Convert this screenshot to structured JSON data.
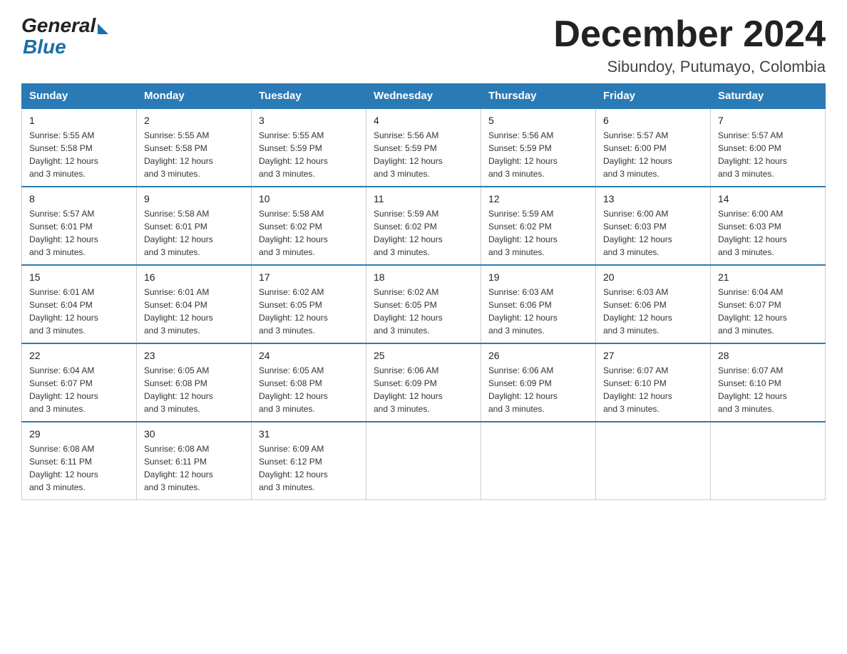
{
  "header": {
    "logo_general": "General",
    "logo_blue": "Blue",
    "title": "December 2024",
    "subtitle": "Sibundoy, Putumayo, Colombia"
  },
  "weekdays": [
    "Sunday",
    "Monday",
    "Tuesday",
    "Wednesday",
    "Thursday",
    "Friday",
    "Saturday"
  ],
  "weeks": [
    [
      {
        "day": "1",
        "info": "Sunrise: 5:55 AM\nSunset: 5:58 PM\nDaylight: 12 hours\nand 3 minutes."
      },
      {
        "day": "2",
        "info": "Sunrise: 5:55 AM\nSunset: 5:58 PM\nDaylight: 12 hours\nand 3 minutes."
      },
      {
        "day": "3",
        "info": "Sunrise: 5:55 AM\nSunset: 5:59 PM\nDaylight: 12 hours\nand 3 minutes."
      },
      {
        "day": "4",
        "info": "Sunrise: 5:56 AM\nSunset: 5:59 PM\nDaylight: 12 hours\nand 3 minutes."
      },
      {
        "day": "5",
        "info": "Sunrise: 5:56 AM\nSunset: 5:59 PM\nDaylight: 12 hours\nand 3 minutes."
      },
      {
        "day": "6",
        "info": "Sunrise: 5:57 AM\nSunset: 6:00 PM\nDaylight: 12 hours\nand 3 minutes."
      },
      {
        "day": "7",
        "info": "Sunrise: 5:57 AM\nSunset: 6:00 PM\nDaylight: 12 hours\nand 3 minutes."
      }
    ],
    [
      {
        "day": "8",
        "info": "Sunrise: 5:57 AM\nSunset: 6:01 PM\nDaylight: 12 hours\nand 3 minutes."
      },
      {
        "day": "9",
        "info": "Sunrise: 5:58 AM\nSunset: 6:01 PM\nDaylight: 12 hours\nand 3 minutes."
      },
      {
        "day": "10",
        "info": "Sunrise: 5:58 AM\nSunset: 6:02 PM\nDaylight: 12 hours\nand 3 minutes."
      },
      {
        "day": "11",
        "info": "Sunrise: 5:59 AM\nSunset: 6:02 PM\nDaylight: 12 hours\nand 3 minutes."
      },
      {
        "day": "12",
        "info": "Sunrise: 5:59 AM\nSunset: 6:02 PM\nDaylight: 12 hours\nand 3 minutes."
      },
      {
        "day": "13",
        "info": "Sunrise: 6:00 AM\nSunset: 6:03 PM\nDaylight: 12 hours\nand 3 minutes."
      },
      {
        "day": "14",
        "info": "Sunrise: 6:00 AM\nSunset: 6:03 PM\nDaylight: 12 hours\nand 3 minutes."
      }
    ],
    [
      {
        "day": "15",
        "info": "Sunrise: 6:01 AM\nSunset: 6:04 PM\nDaylight: 12 hours\nand 3 minutes."
      },
      {
        "day": "16",
        "info": "Sunrise: 6:01 AM\nSunset: 6:04 PM\nDaylight: 12 hours\nand 3 minutes."
      },
      {
        "day": "17",
        "info": "Sunrise: 6:02 AM\nSunset: 6:05 PM\nDaylight: 12 hours\nand 3 minutes."
      },
      {
        "day": "18",
        "info": "Sunrise: 6:02 AM\nSunset: 6:05 PM\nDaylight: 12 hours\nand 3 minutes."
      },
      {
        "day": "19",
        "info": "Sunrise: 6:03 AM\nSunset: 6:06 PM\nDaylight: 12 hours\nand 3 minutes."
      },
      {
        "day": "20",
        "info": "Sunrise: 6:03 AM\nSunset: 6:06 PM\nDaylight: 12 hours\nand 3 minutes."
      },
      {
        "day": "21",
        "info": "Sunrise: 6:04 AM\nSunset: 6:07 PM\nDaylight: 12 hours\nand 3 minutes."
      }
    ],
    [
      {
        "day": "22",
        "info": "Sunrise: 6:04 AM\nSunset: 6:07 PM\nDaylight: 12 hours\nand 3 minutes."
      },
      {
        "day": "23",
        "info": "Sunrise: 6:05 AM\nSunset: 6:08 PM\nDaylight: 12 hours\nand 3 minutes."
      },
      {
        "day": "24",
        "info": "Sunrise: 6:05 AM\nSunset: 6:08 PM\nDaylight: 12 hours\nand 3 minutes."
      },
      {
        "day": "25",
        "info": "Sunrise: 6:06 AM\nSunset: 6:09 PM\nDaylight: 12 hours\nand 3 minutes."
      },
      {
        "day": "26",
        "info": "Sunrise: 6:06 AM\nSunset: 6:09 PM\nDaylight: 12 hours\nand 3 minutes."
      },
      {
        "day": "27",
        "info": "Sunrise: 6:07 AM\nSunset: 6:10 PM\nDaylight: 12 hours\nand 3 minutes."
      },
      {
        "day": "28",
        "info": "Sunrise: 6:07 AM\nSunset: 6:10 PM\nDaylight: 12 hours\nand 3 minutes."
      }
    ],
    [
      {
        "day": "29",
        "info": "Sunrise: 6:08 AM\nSunset: 6:11 PM\nDaylight: 12 hours\nand 3 minutes."
      },
      {
        "day": "30",
        "info": "Sunrise: 6:08 AM\nSunset: 6:11 PM\nDaylight: 12 hours\nand 3 minutes."
      },
      {
        "day": "31",
        "info": "Sunrise: 6:09 AM\nSunset: 6:12 PM\nDaylight: 12 hours\nand 3 minutes."
      },
      {
        "day": "",
        "info": ""
      },
      {
        "day": "",
        "info": ""
      },
      {
        "day": "",
        "info": ""
      },
      {
        "day": "",
        "info": ""
      }
    ]
  ]
}
